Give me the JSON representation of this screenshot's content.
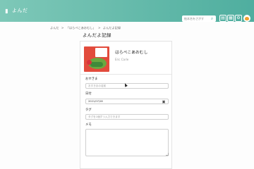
{
  "header": {
    "logo_icon": "book-icon",
    "app_name": "よんだ",
    "search_placeholder": "絵本名をさがす",
    "buttons": [
      "bookshelf-icon",
      "grid-icon",
      "settings-icon"
    ],
    "accent_color": "#4fae9f"
  },
  "breadcrumb": {
    "items": [
      "よんだ",
      "「はらぺこあおむし」",
      "よんだよ記録"
    ],
    "separator": ">"
  },
  "page": {
    "title": "よんだよ記録"
  },
  "book": {
    "title": "はらぺこあおむし",
    "author": "Eric Carle"
  },
  "form": {
    "child_label": "おすきま",
    "child_placeholder": "おすきまの名前",
    "date_label": "日付",
    "date_value": "2021/07/28",
    "tag_label": "タグ",
    "tag_placeholder": "タグを1個ずつ入力できます",
    "memo_label": "メモ"
  }
}
